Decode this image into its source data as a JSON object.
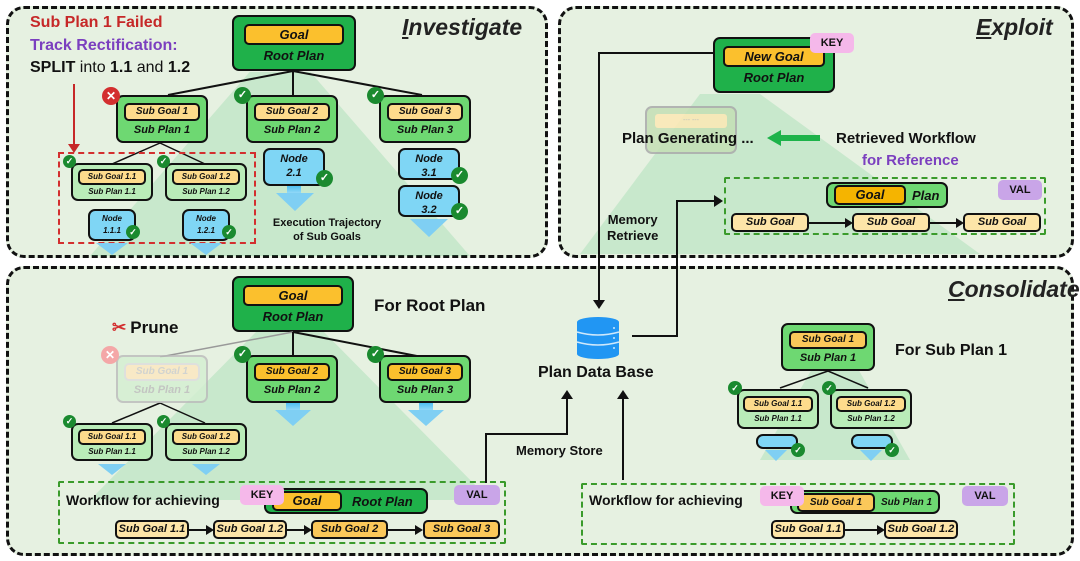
{
  "panels": {
    "investigate": {
      "title_first": "I",
      "title_rest": "nvestigate",
      "failed_text": "Sub Plan 1 Failed",
      "rectify_text": "Track Rectification:",
      "split_prefix": "SPLIT",
      "split_mid": " into ",
      "split_a": "1.1",
      "split_and": " and ",
      "split_b": "1.2",
      "root": {
        "goal": "Goal",
        "plan": "Root Plan"
      },
      "subs": [
        {
          "goal": "Sub Goal 1",
          "plan": "Sub Plan 1",
          "status": "failed"
        },
        {
          "goal": "Sub Goal 2",
          "plan": "Sub Plan 2",
          "status": "success"
        },
        {
          "goal": "Sub Goal 3",
          "plan": "Sub Plan 3",
          "status": "success"
        }
      ],
      "split_subs": [
        {
          "goal": "Sub Goal 1.1",
          "plan": "Sub Plan 1.1"
        },
        {
          "goal": "Sub Goal 1.2",
          "plan": "Sub Plan 1.2"
        }
      ],
      "nodes": [
        {
          "line1": "Node",
          "line2": "1.1.1"
        },
        {
          "line1": "Node",
          "line2": "1.2.1"
        },
        {
          "line1": "Node",
          "line2": "2.1"
        },
        {
          "line1": "Node",
          "line2": "3.1"
        },
        {
          "line1": "Node",
          "line2": "3.2"
        }
      ],
      "trajectory_line1": "Execution Trajectory",
      "trajectory_line2": "of Sub Goals"
    },
    "exploit": {
      "title_first": "E",
      "title_rest": "xploit",
      "root": {
        "goal": "New Goal",
        "plan": "Root Plan"
      },
      "key_tag": "KEY",
      "val_tag": "VAL",
      "generating_placeholder": "--- ---",
      "generating_text": "Plan Generating ...",
      "retrieved_line1": "Retrieved Workflow",
      "retrieved_line2": "for Reference",
      "workflow": {
        "goal": "Goal",
        "plan": "Plan",
        "steps": [
          "Sub Goal",
          "Sub Goal",
          "Sub Goal"
        ]
      },
      "memory_retrieve_line1": "Memory",
      "memory_retrieve_line2": "Retrieve"
    },
    "consolidate": {
      "title_first": "C",
      "title_rest": "onsolidate",
      "for_root": "For Root Plan",
      "prune": "Prune",
      "root": {
        "goal": "Goal",
        "plan": "Root Plan"
      },
      "subs": [
        {
          "goal": "Sub Goal 1",
          "plan": "Sub Plan 1",
          "status": "pruned"
        },
        {
          "goal": "Sub Goal 2",
          "plan": "Sub Plan 2",
          "status": "success"
        },
        {
          "goal": "Sub Goal 3",
          "plan": "Sub Plan 3",
          "status": "success"
        }
      ],
      "split_subs": [
        {
          "goal": "Sub Goal 1.1",
          "plan": "Sub Plan 1.1"
        },
        {
          "goal": "Sub Goal 1.2",
          "plan": "Sub Plan 1.2"
        }
      ],
      "workflow_root": {
        "label": "Workflow for achieving",
        "key_tag": "KEY",
        "val_tag": "VAL",
        "goal": "Goal",
        "plan": "Root Plan",
        "steps": [
          "Sub Goal 1.1",
          "Sub Goal 1.2",
          "Sub Goal 2",
          "Sub Goal 3"
        ]
      },
      "db_label": "Plan Data Base",
      "memory_store": "Memory Store",
      "for_sub": "For Sub Plan 1",
      "sub_tree": {
        "goal": "Sub Goal 1",
        "plan": "Sub Plan 1",
        "children": [
          {
            "goal": "Sub Goal 1.1",
            "plan": "Sub Plan 1.1"
          },
          {
            "goal": "Sub Goal 1.2",
            "plan": "Sub Plan 1.2"
          }
        ]
      },
      "workflow_sub": {
        "label": "Workflow for achieving",
        "key_tag": "KEY",
        "val_tag": "VAL",
        "goal": "Sub Goal 1",
        "plan": "Sub Plan 1",
        "steps": [
          "Sub Goal 1.1",
          "Sub Goal 1.2"
        ]
      }
    }
  },
  "icons": {
    "check": "✓",
    "cross": "✕",
    "arrow_left": "⟵",
    "prune_icon": "✂"
  },
  "colors": {
    "root": "#1fb14a",
    "sub": "#6ed872",
    "goal": "#fbc02d",
    "node": "#7fd6f5",
    "failed": "#d32f2f",
    "rectify": "#7b3fbf",
    "key": "#f5b8ea",
    "val": "#c9a5e8"
  }
}
